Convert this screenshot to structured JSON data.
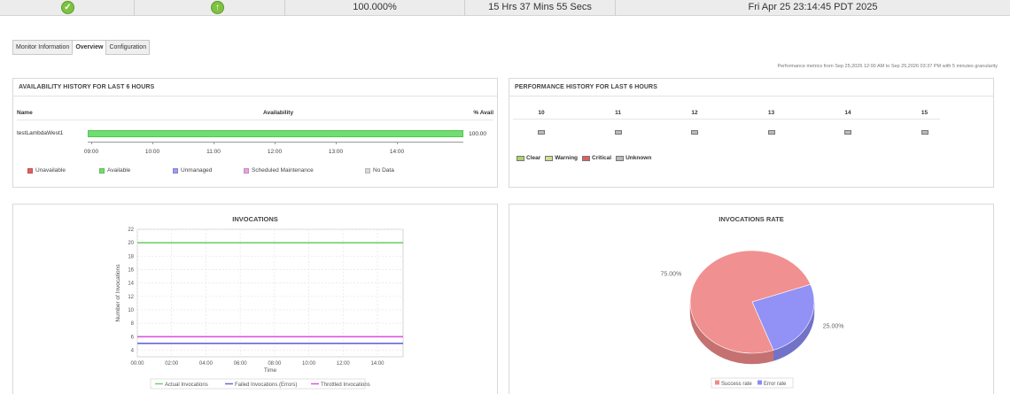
{
  "statusbar": {
    "availability": "100.000%",
    "uptime": "15 Hrs 37 Mins 55 Secs",
    "last_polled": "Fri Apr 25 23:14:45 PDT 2025"
  },
  "tabs": [
    {
      "label": "Monitor Information",
      "active": false
    },
    {
      "label": "Overview",
      "active": true
    },
    {
      "label": "Configuration",
      "active": false
    }
  ],
  "perf_note": "Performance metrics from Sep 25,2026 12:00 AM to Sep 25,2026 03:37 PM with 5 minutes granularity",
  "availability_panel": {
    "title": "AVAILABILITY HISTORY FOR LAST 6 HOURS",
    "col_name": "Name",
    "col_availability": "Availability",
    "col_pct": "% Avail",
    "monitor": "testLambdaWest1",
    "pct": "100.00",
    "available_fraction": 1.0,
    "ticks": [
      "09:00",
      "10:00",
      "11:00",
      "12:00",
      "13:00",
      "14:00"
    ],
    "legend": [
      {
        "label": "Unavailable",
        "color": "#e06060"
      },
      {
        "label": "Available",
        "color": "#6fdd6f"
      },
      {
        "label": "Unmanaged",
        "color": "#9c9cf0"
      },
      {
        "label": "Scheduled Maintenance",
        "color": "#e7a4e0"
      },
      {
        "label": "No Data",
        "color": "#d8d8d8"
      }
    ]
  },
  "performance_panel": {
    "title": "PERFORMANCE HISTORY FOR LAST 6 HOURS",
    "hours": [
      "10",
      "11",
      "12",
      "13",
      "14",
      "15"
    ],
    "legend": [
      {
        "label": "Clear",
        "color": "#a8d46f"
      },
      {
        "label": "Warning",
        "color": "#cde08a"
      },
      {
        "label": "Critical",
        "color": "#e06060"
      },
      {
        "label": "Unknown",
        "color": "#bbbbbb"
      }
    ]
  },
  "chart_data": [
    {
      "type": "line",
      "title": "INVOCATIONS",
      "xlabel": "Time",
      "ylabel": "Number of Invocations",
      "x": [
        "00:00",
        "02:00",
        "04:00",
        "06:00",
        "08:00",
        "10:00",
        "12:00",
        "14:00"
      ],
      "xlim": [
        0,
        15.5
      ],
      "ylim": [
        3,
        22
      ],
      "yticks": [
        4,
        6,
        8,
        10,
        12,
        14,
        16,
        18,
        20,
        22
      ],
      "series": [
        {
          "name": "Actual Invocations",
          "color": "#6fd16f",
          "x": [
            0,
            15.5
          ],
          "y": [
            20,
            20
          ]
        },
        {
          "name": "Failed Invocations (Errors)",
          "color": "#6666dd",
          "x": [
            0,
            15.5
          ],
          "y": [
            5,
            5
          ]
        },
        {
          "name": "Throttled Invocations",
          "color": "#dd55dd",
          "x": [
            0,
            15.5
          ],
          "y": [
            6,
            6
          ]
        }
      ]
    },
    {
      "type": "pie",
      "title": "INVOCATIONS RATE",
      "slices": [
        {
          "name": "Success rate",
          "value": 75.0,
          "label": "75.00%",
          "color": "#f08a8a"
        },
        {
          "name": "Error rate",
          "value": 25.0,
          "label": "25.00%",
          "color": "#8b8bf5"
        }
      ]
    }
  ]
}
